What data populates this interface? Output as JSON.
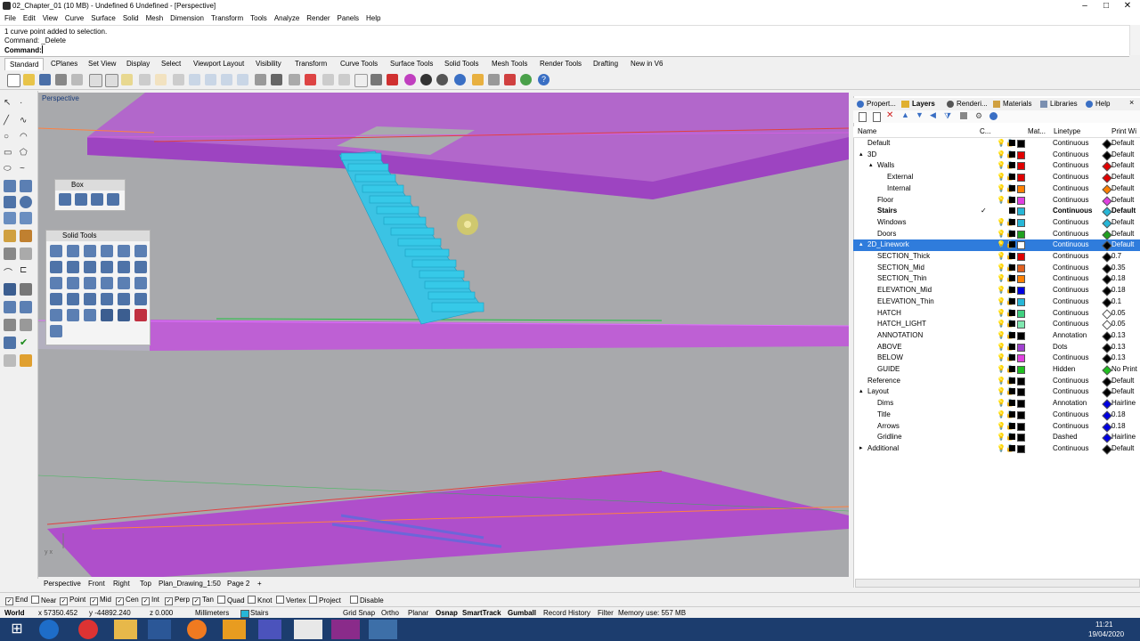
{
  "window": {
    "title": "02_Chapter_01 (10 MB) - Undefined 6 Undefined - [Perspective]"
  },
  "menu": [
    "File",
    "Edit",
    "View",
    "Curve",
    "Surface",
    "Solid",
    "Mesh",
    "Dimension",
    "Transform",
    "Tools",
    "Analyze",
    "Render",
    "Panels",
    "Help"
  ],
  "command": {
    "line1": "1 curve point added to selection.",
    "line2": "Command: _Delete",
    "prompt": "Command:"
  },
  "toolbar_tabs": [
    "Standard",
    "CPlanes",
    "Set View",
    "Display",
    "Select",
    "Viewport Layout",
    "Visibility",
    "Transform",
    "Curve Tools",
    "Surface Tools",
    "Solid Tools",
    "Mesh Tools",
    "Render Tools",
    "Drafting",
    "New in V6"
  ],
  "viewport": {
    "label": "Perspective",
    "axis_label": "y x"
  },
  "floating_panels": {
    "box": "Box",
    "solid_tools": "Solid Tools"
  },
  "viewport_tabs": [
    "Perspective",
    "Front",
    "Right",
    "Top",
    "Plan_Drawing_1:50",
    "Page 2"
  ],
  "osnaps": [
    {
      "label": "End",
      "checked": true
    },
    {
      "label": "Near",
      "checked": false
    },
    {
      "label": "Point",
      "checked": true
    },
    {
      "label": "Mid",
      "checked": true
    },
    {
      "label": "Cen",
      "checked": true
    },
    {
      "label": "Int",
      "checked": true
    },
    {
      "label": "Perp",
      "checked": true
    },
    {
      "label": "Tan",
      "checked": true
    },
    {
      "label": "Quad",
      "checked": false
    },
    {
      "label": "Knot",
      "checked": false
    },
    {
      "label": "Vertex",
      "checked": false
    },
    {
      "label": "Project",
      "checked": false
    },
    {
      "label": "Disable",
      "checked": false
    }
  ],
  "status": {
    "cplane": "World",
    "x": "x 57350.452",
    "y": "y -44892.240",
    "z": "z 0.000",
    "units": "Millimeters",
    "layer": "Stairs",
    "toggles": [
      "Grid Snap",
      "Ortho",
      "Planar",
      "Osnap",
      "SmartTrack",
      "Gumball",
      "Record History",
      "Filter"
    ],
    "memory": "Memory use: 557 MB"
  },
  "panel_tabs": [
    "Propert...",
    "Layers",
    "Renderi...",
    "Materials",
    "Libraries",
    "Help"
  ],
  "layers_header": {
    "name": "Name",
    "current": "C...",
    "material": "Mat...",
    "linetype": "Linetype",
    "print": "Print Wi"
  },
  "layers": [
    {
      "name": "Default",
      "indent": 0,
      "color": "#000000",
      "linetype": "Continuous",
      "print": "Default",
      "pcolor": "#000000"
    },
    {
      "name": "3D",
      "indent": 0,
      "expand": "▴",
      "color": "#e00000",
      "linetype": "Continuous",
      "print": "Default",
      "pcolor": "#000000"
    },
    {
      "name": "Walls",
      "indent": 1,
      "expand": "▴",
      "color": "#e00000",
      "linetype": "Continuous",
      "print": "Default",
      "pcolor": "#e00000"
    },
    {
      "name": "External",
      "indent": 2,
      "color": "#e00000",
      "linetype": "Continuous",
      "print": "Default",
      "pcolor": "#e00000"
    },
    {
      "name": "Internal",
      "indent": 2,
      "color": "#ff8000",
      "linetype": "Continuous",
      "print": "Default",
      "pcolor": "#ff8000"
    },
    {
      "name": "Floor",
      "indent": 1,
      "color": "#e040e0",
      "linetype": "Continuous",
      "print": "Default",
      "pcolor": "#e040e0"
    },
    {
      "name": "Stairs",
      "indent": 1,
      "color": "#27b7d7",
      "linetype": "Continuous",
      "print": "Default",
      "pcolor": "#27b7d7",
      "current": true,
      "bold": true
    },
    {
      "name": "Windows",
      "indent": 1,
      "color": "#27b7d7",
      "linetype": "Continuous",
      "print": "Default",
      "pcolor": "#27b7d7"
    },
    {
      "name": "Doors",
      "indent": 1,
      "color": "#20a020",
      "linetype": "Continuous",
      "print": "Default",
      "pcolor": "#20a020"
    },
    {
      "name": "2D_Linework",
      "indent": 0,
      "expand": "▴",
      "color": "#ffffff",
      "linetype": "Continuous",
      "print": "Default",
      "pcolor": "#000000",
      "selected": true
    },
    {
      "name": "SECTION_Thick",
      "indent": 1,
      "color": "#e00000",
      "linetype": "Continuous",
      "print": "0.7",
      "pcolor": "#000000"
    },
    {
      "name": "SECTION_Mid",
      "indent": 1,
      "color": "#e06020",
      "linetype": "Continuous",
      "print": "0.35",
      "pcolor": "#000000"
    },
    {
      "name": "SECTION_Thin",
      "indent": 1,
      "color": "#ff8000",
      "linetype": "Continuous",
      "print": "0.18",
      "pcolor": "#000000"
    },
    {
      "name": "ELEVATION_Mid",
      "indent": 1,
      "color": "#0000e0",
      "linetype": "Continuous",
      "print": "0.18",
      "pcolor": "#000000"
    },
    {
      "name": "ELEVATION_Thin",
      "indent": 1,
      "color": "#27b7d7",
      "linetype": "Continuous",
      "print": "0.1",
      "pcolor": "#000000"
    },
    {
      "name": "HATCH",
      "indent": 1,
      "color": "#40d080",
      "linetype": "Continuous",
      "print": "0.05",
      "pcolor": "#ffffff"
    },
    {
      "name": "HATCH_LIGHT",
      "indent": 1,
      "color": "#80e8b0",
      "linetype": "Continuous",
      "print": "0.05",
      "pcolor": "#ffffff"
    },
    {
      "name": "ANNOTATION",
      "indent": 1,
      "color": "#000000",
      "linetype": "Annotation",
      "print": "0.13",
      "pcolor": "#000000"
    },
    {
      "name": "ABOVE",
      "indent": 1,
      "color": "#a040d0",
      "linetype": "Dots",
      "print": "0.13",
      "pcolor": "#000000"
    },
    {
      "name": "BELOW",
      "indent": 1,
      "color": "#e040e0",
      "linetype": "Continuous",
      "print": "0.13",
      "pcolor": "#000000"
    },
    {
      "name": "GUIDE",
      "indent": 1,
      "color": "#20c020",
      "linetype": "Hidden",
      "print": "No Print",
      "pcolor": "#20c020"
    },
    {
      "name": "Reference",
      "indent": 0,
      "color": "#000000",
      "linetype": "Continuous",
      "print": "Default",
      "pcolor": "#000000"
    },
    {
      "name": "Layout",
      "indent": 0,
      "expand": "▴",
      "color": "#000000",
      "linetype": "Continuous",
      "print": "Default",
      "pcolor": "#000000"
    },
    {
      "name": "Dims",
      "indent": 1,
      "color": "#000000",
      "linetype": "Annotation",
      "print": "Hairline",
      "pcolor": "#0000e0"
    },
    {
      "name": "Title",
      "indent": 1,
      "color": "#000000",
      "linetype": "Continuous",
      "print": "0.18",
      "pcolor": "#0000e0"
    },
    {
      "name": "Arrows",
      "indent": 1,
      "color": "#000000",
      "linetype": "Continuous",
      "print": "0.18",
      "pcolor": "#0000e0"
    },
    {
      "name": "Gridline",
      "indent": 1,
      "color": "#000000",
      "linetype": "Dashed",
      "print": "Hairline",
      "pcolor": "#0000e0"
    },
    {
      "name": "Additional",
      "indent": 0,
      "expand": "▸",
      "color": "#000000",
      "linetype": "Continuous",
      "print": "Default",
      "pcolor": "#000000"
    }
  ],
  "clock": {
    "time": "11:21",
    "date": "19/04/2020"
  }
}
